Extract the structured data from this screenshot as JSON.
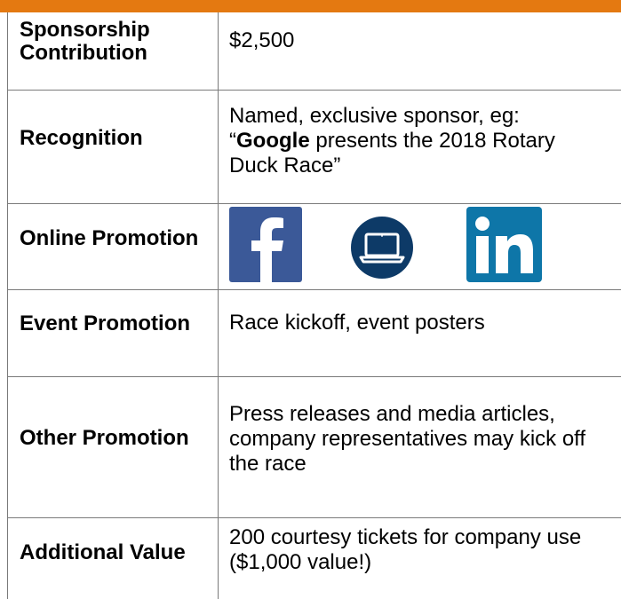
{
  "accent_color": "#e47911",
  "rows": [
    {
      "label": "Sponsorship Contribution",
      "value": "$2,500"
    },
    {
      "label": "Recognition",
      "value_prefix": "Named, exclusive sponsor, eg:",
      "value_quote_open": "“",
      "value_bold": "Google",
      "value_suffix": " presents the 2018 Rotary Duck Race”"
    },
    {
      "label": "Online Promotion",
      "icons": [
        "facebook-icon",
        "laptop-icon",
        "linkedin-icon"
      ]
    },
    {
      "label": "Event Promotion",
      "value": "Race kickoff, event posters"
    },
    {
      "label": "Other Promotion",
      "value": "Press releases and media articles, company representatives may kick off the race"
    },
    {
      "label": "Additional Value",
      "value": "200 courtesy tickets for company use ($1,000 value!)"
    }
  ]
}
